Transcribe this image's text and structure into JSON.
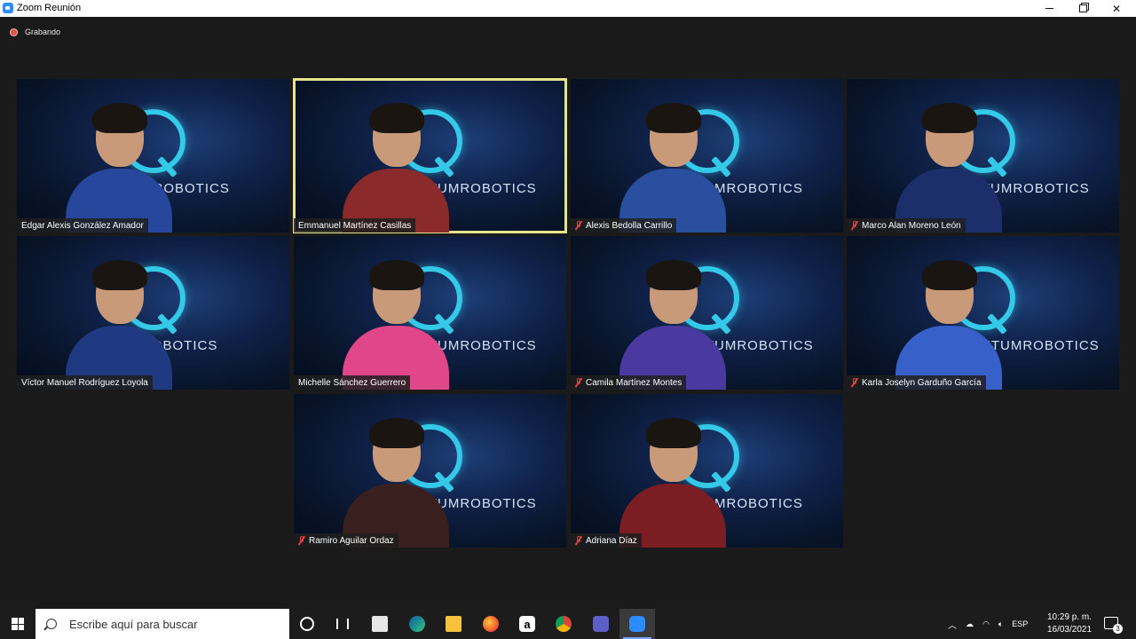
{
  "window": {
    "title": "Zoom Reunión",
    "recording_label": "Grabando"
  },
  "tiles": [
    {
      "name": "Edgar Alexis González Amador",
      "muted": false,
      "active": false,
      "brand": "MROBOTICS",
      "shirt": "#27479c"
    },
    {
      "name": "Emmanuel Martínez Casillas",
      "muted": false,
      "active": true,
      "brand": "NTUMROBOTICS",
      "shirt": "#8b2a2a"
    },
    {
      "name": "Alexis Bedolla Carrillo",
      "muted": true,
      "active": false,
      "brand": "TUMROBOTICS",
      "shirt": "#2a4f9e"
    },
    {
      "name": "Marco Alan Moreno León",
      "muted": true,
      "active": false,
      "brand": "NTUMROBOTICS",
      "shirt": "#1d2f6b"
    },
    {
      "name": "Víctor Manuel Rodríguez Loyola",
      "muted": false,
      "active": false,
      "brand": "ROBOTICS",
      "shirt": "#1f3a80"
    },
    {
      "name": "Michelle Sánchez Guerrero",
      "muted": false,
      "active": false,
      "brand": "NTUMROBOTICS",
      "shirt": "#e0468a"
    },
    {
      "name": "Camila Martínez Montes",
      "muted": true,
      "active": false,
      "brand": "NTUMROBOTICS",
      "shirt": "#4a3aa0"
    },
    {
      "name": "Karla Joselyn Garduño García",
      "muted": true,
      "active": false,
      "brand": "ANTUMROBOTICS",
      "shirt": "#3760c9"
    },
    {
      "name": "Ramiro  Aguilar Ordaz",
      "muted": true,
      "active": false,
      "brand": "NTUMROBOTICS",
      "shirt": "#3a1f1f"
    },
    {
      "name": "Adriana Díaz",
      "muted": true,
      "active": false,
      "brand": "TUMROBOTICS",
      "shirt": "#7a1e24"
    }
  ],
  "taskbar": {
    "search_placeholder": "Escribe aquí para buscar",
    "apps": [
      "cortana-icon",
      "task-view-icon",
      "store-icon",
      "edge-icon",
      "file-explorer-icon",
      "firefox-icon",
      "amazon-icon",
      "chrome-icon",
      "teams-icon",
      "zoom-icon"
    ],
    "language": "ESP",
    "time": "10:29 p. m.",
    "date": "16/03/2021",
    "notification_count": "3"
  },
  "colors": {
    "active_speaker": "#e3e58f",
    "logo": "#35c9e8",
    "mute": "#e04040"
  }
}
